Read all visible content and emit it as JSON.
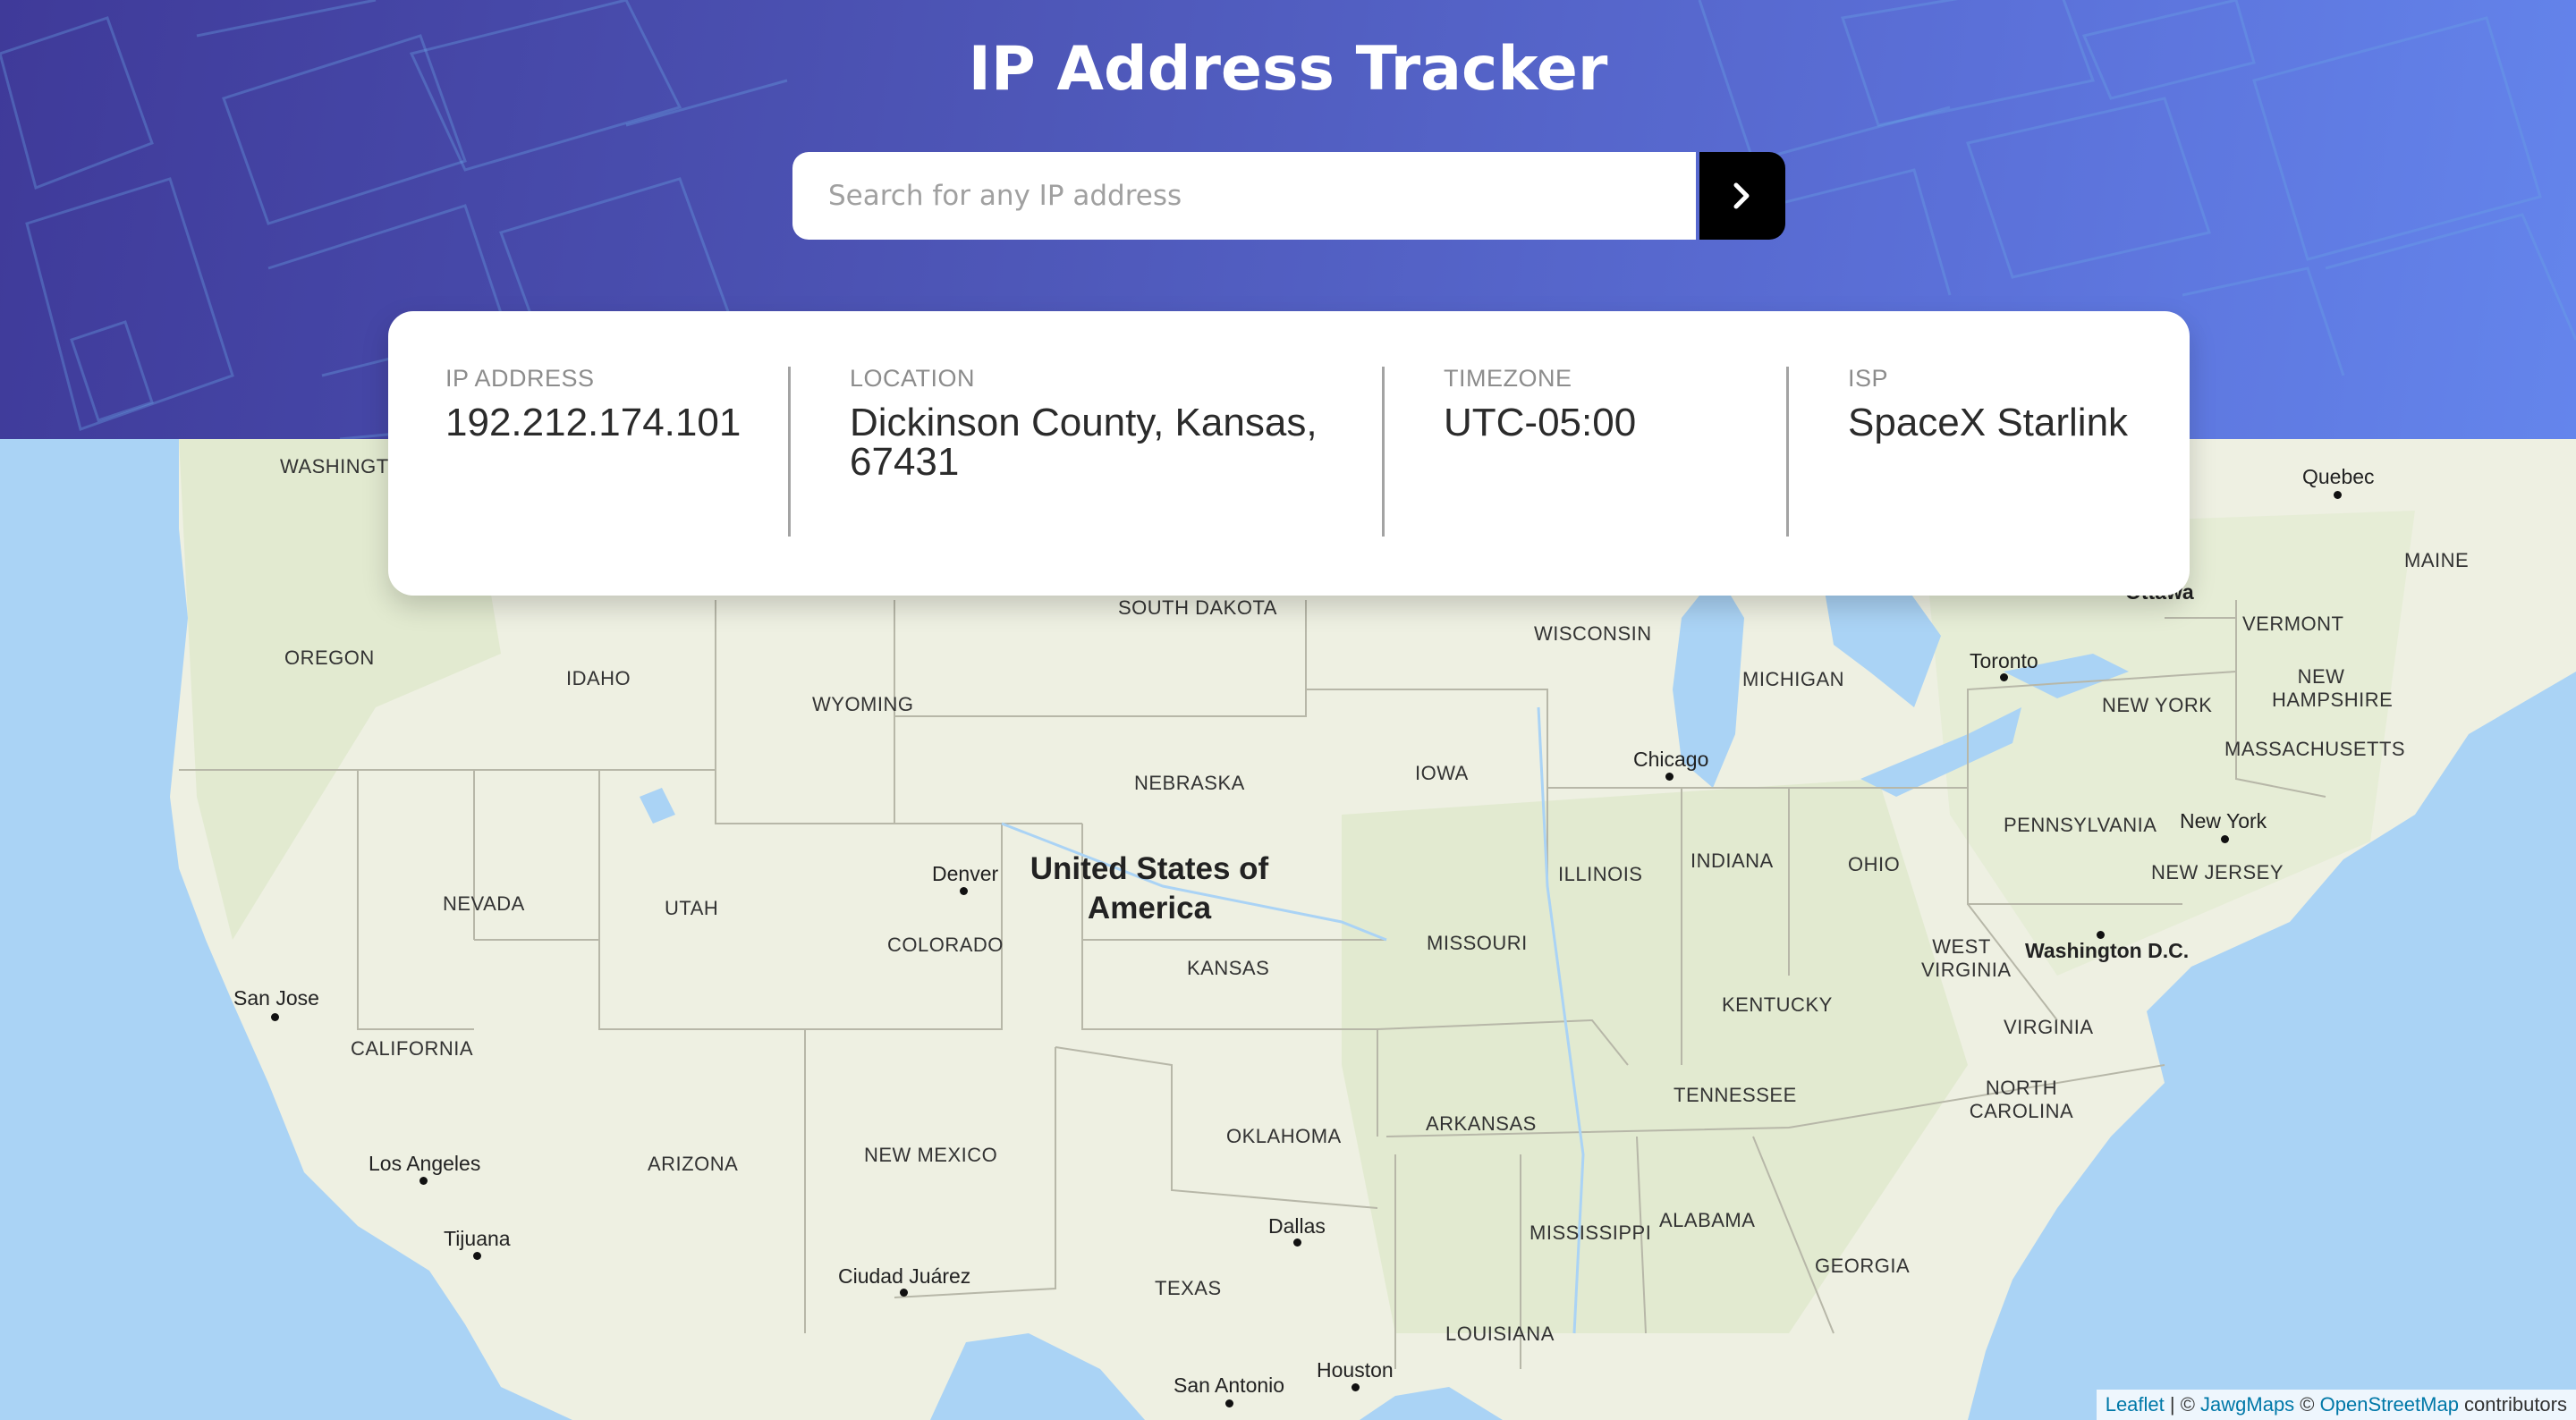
{
  "header": {
    "title": "IP Address Tracker",
    "search_placeholder": "Search for any IP address",
    "search_button_icon": "chevron-right-icon"
  },
  "info": [
    {
      "label": "IP ADDRESS",
      "value": "192.212.174.101"
    },
    {
      "label": "LOCATION",
      "value": "Dickinson County, Kansas, 67431"
    },
    {
      "label": "TIMEZONE",
      "value": "UTC-05:00"
    },
    {
      "label": "ISP",
      "value": "SpaceX Starlink"
    }
  ],
  "map": {
    "country": "United States of America",
    "states": [
      "WASHINGTON",
      "OREGON",
      "IDAHO",
      "WYOMING",
      "SOUTH DAKOTA",
      "NEBRASKA",
      "IOWA",
      "WISCONSIN",
      "MICHIGAN",
      "NEVADA",
      "UTAH",
      "COLORADO",
      "KANSAS",
      "MISSOURI",
      "ILLINOIS",
      "INDIANA",
      "OHIO",
      "CALIFORNIA",
      "ARIZONA",
      "NEW MEXICO",
      "OKLAHOMA",
      "ARKANSAS",
      "TENNESSEE",
      "KENTUCKY",
      "WEST VIRGINIA",
      "VIRGINIA",
      "NORTH CAROLINA",
      "MISSISSIPPI",
      "ALABAMA",
      "GEORGIA",
      "TEXAS",
      "LOUISIANA",
      "PENNSYLVANIA",
      "NEW YORK",
      "NEW JERSEY",
      "MASSACHUSETTS",
      "NEW HAMPSHIRE",
      "VERMONT",
      "MAINE"
    ],
    "cities": [
      "Quebec",
      "Ottawa",
      "Toronto",
      "Chicago",
      "Denver",
      "New York",
      "Washington D.C.",
      "San Jose",
      "Los Angeles",
      "Tijuana",
      "Dallas",
      "Ciudad Juárez",
      "Houston",
      "San Antonio"
    ],
    "attribution": {
      "leaflet": "Leaflet",
      "sep": " | © ",
      "jawg": "JawgMaps",
      "osm_prefix": " © ",
      "osm": "OpenStreetMap",
      "suffix": " contributors"
    }
  },
  "colors": {
    "accent": "#000000",
    "water": "#aad3f5",
    "land": "#eef0e2"
  }
}
